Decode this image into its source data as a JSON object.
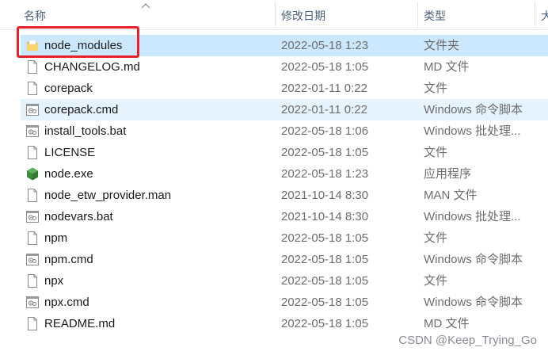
{
  "header": {
    "col_name": "名称",
    "col_date": "修改日期",
    "col_type": "类型",
    "col_size": "大"
  },
  "files": [
    {
      "name": "node_modules",
      "date": "2022-05-18 1:23",
      "type": "文件夹",
      "icon": "folder-icon",
      "state": "selected"
    },
    {
      "name": "CHANGELOG.md",
      "date": "2022-05-18 1:05",
      "type": "MD 文件",
      "icon": "file-icon"
    },
    {
      "name": "corepack",
      "date": "2022-01-11 0:22",
      "type": "文件",
      "icon": "file-icon"
    },
    {
      "name": "corepack.cmd",
      "date": "2022-01-11 0:22",
      "type": "Windows 命令脚本",
      "icon": "script-file-icon",
      "state": "hover"
    },
    {
      "name": "install_tools.bat",
      "date": "2022-05-18 1:06",
      "type": "Windows 批处理...",
      "icon": "script-file-icon"
    },
    {
      "name": "LICENSE",
      "date": "2022-05-18 1:05",
      "type": "文件",
      "icon": "file-icon"
    },
    {
      "name": "node.exe",
      "date": "2022-05-18 1:23",
      "type": "应用程序",
      "icon": "nodejs-hexagon-icon"
    },
    {
      "name": "node_etw_provider.man",
      "date": "2021-10-14 8:30",
      "type": "MAN 文件",
      "icon": "file-icon"
    },
    {
      "name": "nodevars.bat",
      "date": "2021-10-14 8:30",
      "type": "Windows 批处理...",
      "icon": "script-file-icon"
    },
    {
      "name": "npm",
      "date": "2022-05-18 1:05",
      "type": "文件",
      "icon": "file-icon"
    },
    {
      "name": "npm.cmd",
      "date": "2022-05-18 1:05",
      "type": "Windows 命令脚本",
      "icon": "script-file-icon"
    },
    {
      "name": "npx",
      "date": "2022-05-18 1:05",
      "type": "文件",
      "icon": "file-icon"
    },
    {
      "name": "npx.cmd",
      "date": "2022-05-18 1:05",
      "type": "Windows 命令脚本",
      "icon": "script-file-icon"
    },
    {
      "name": "README.md",
      "date": "2022-05-18 1:05",
      "type": "MD 文件",
      "icon": "file-icon"
    }
  ],
  "watermark": "CSDN @Keep_Trying_Go",
  "colors": {
    "selected_bg": "#cce8ff",
    "hover_bg": "#e5f3ff",
    "highlight_border": "#e8202a",
    "folder_yellow": "#f4c94e",
    "node_green": "#3c8d3a"
  }
}
